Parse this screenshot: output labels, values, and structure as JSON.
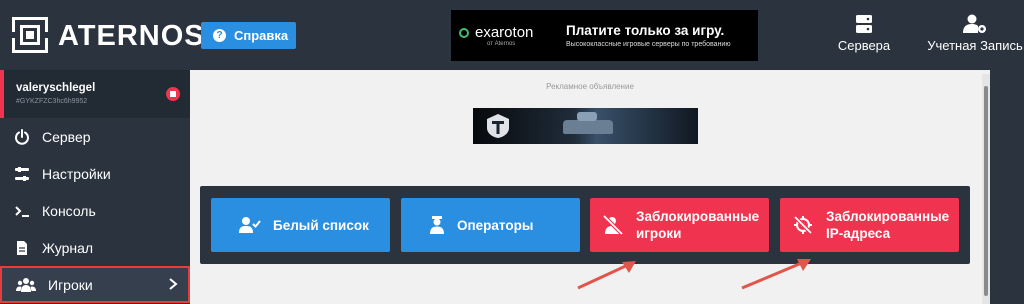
{
  "header": {
    "brand": "ATERNOS",
    "help_label": "Справка",
    "help_icon": "?",
    "nav": [
      {
        "label": "Сервера",
        "icon": "server-stack-icon"
      },
      {
        "label": "Учетная Запись",
        "icon": "user-gear-icon"
      }
    ]
  },
  "top_ad": {
    "brand": "exaroton",
    "brand_sub": "от Aternos",
    "headline": "Платите только за игру.",
    "subline": "Высококлассные игровые серверы по требованию"
  },
  "sidebar": {
    "user": {
      "name": "valeryschlegel",
      "id": "#GYKZFZC3hc6h9952"
    },
    "items": [
      {
        "label": "Сервер",
        "icon": "power-icon"
      },
      {
        "label": "Настройки",
        "icon": "sliders-icon"
      },
      {
        "label": "Консоль",
        "icon": "terminal-icon"
      },
      {
        "label": "Журнал",
        "icon": "document-icon"
      },
      {
        "label": "Игроки",
        "icon": "users-icon",
        "active": true
      }
    ]
  },
  "main": {
    "ad_label": "Рекламное объявление",
    "buttons": [
      {
        "label": "Белый список",
        "icon": "user-check-icon",
        "color": "#2a8fe0"
      },
      {
        "label": "Операторы",
        "icon": "user-operator-icon",
        "color": "#2a8fe0"
      },
      {
        "label_line1": "Заблокированные",
        "label_line2": "игроки",
        "icon": "user-slash-icon",
        "color": "#f0334e"
      },
      {
        "label_line1": "Заблокированные",
        "label_line2": "IP-адреса",
        "icon": "location-slash-icon",
        "color": "#f0334e"
      }
    ]
  },
  "colors": {
    "accent_blue": "#2a8fe0",
    "accent_red": "#f0334e",
    "dark": "#2b333f"
  }
}
